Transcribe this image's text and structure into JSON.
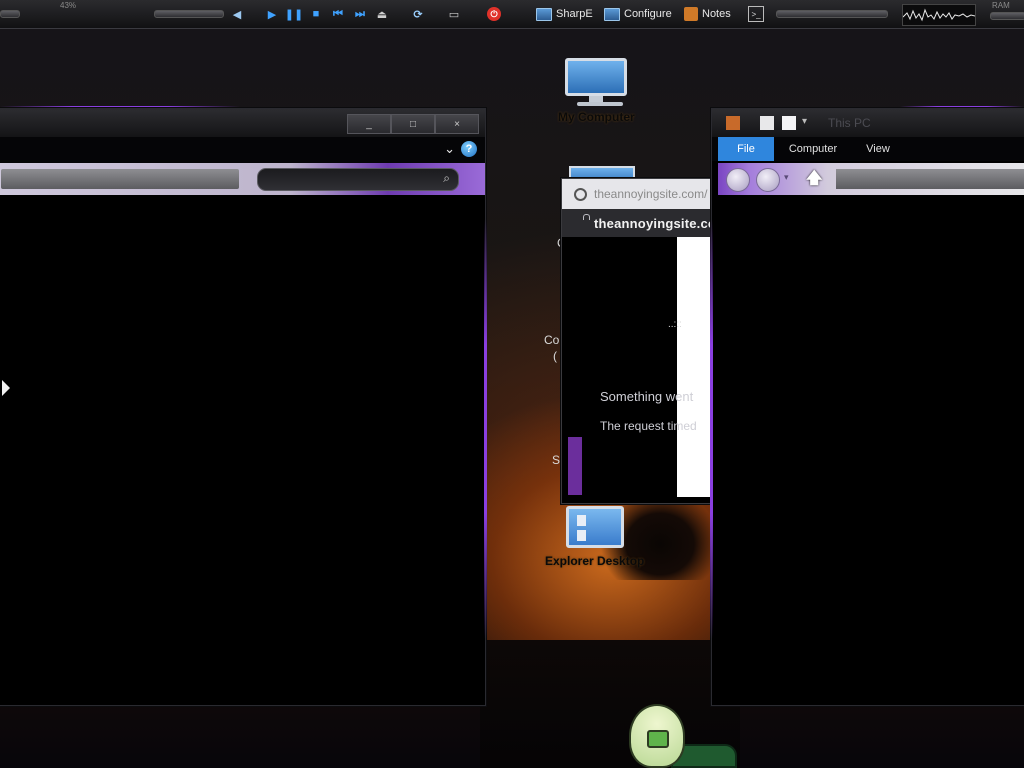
{
  "taskbar": {
    "corner_percent": "43%",
    "shortcuts": [
      {
        "label": "SharpE",
        "icon": "monitor-icon"
      },
      {
        "label": "Configure",
        "icon": "monitor-icon"
      },
      {
        "label": "Notes",
        "icon": "notes-icon"
      }
    ],
    "ram_label": "RAM",
    "colors": {
      "accent_blue": "#3fa2ff",
      "power_red": "#e0322a"
    }
  },
  "left_window": {
    "controls": {
      "minimize": "_",
      "maximize": "□",
      "close": "×"
    },
    "help_glyph": "?",
    "chevron_glyph": "⌄",
    "search_icon": "⌕"
  },
  "right_window": {
    "title": "This PC",
    "menu": [
      {
        "label": "File",
        "active": true
      },
      {
        "label": "Computer",
        "active": false
      },
      {
        "label": "View",
        "active": false
      }
    ],
    "up_glyph": "🡅"
  },
  "desktop": {
    "icons": [
      {
        "label": "My Computer"
      },
      {
        "label": "Explorer Desktop"
      }
    ],
    "stray_letters": [
      "C",
      "Co",
      "(",
      "S"
    ]
  },
  "browser": {
    "url_gray": "theannoyingsite.com/",
    "url_main": "theannoyingsite.co",
    "loading_dots": "..:::",
    "error_title": "Something went",
    "error_detail": "The request timed"
  },
  "colors": {
    "accent_purple": "#8a3fe0",
    "ribbon_active": "#2f86dd"
  }
}
